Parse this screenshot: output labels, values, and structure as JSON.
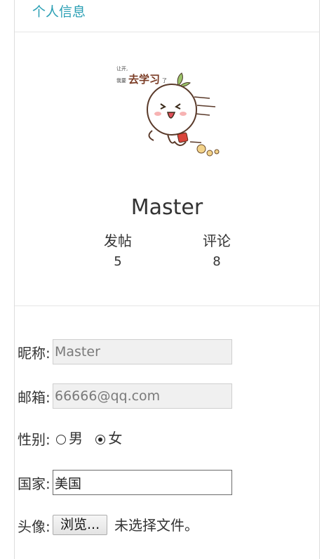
{
  "panel": {
    "title": "个人信息"
  },
  "profile": {
    "avatar_caption": "让开, 我要去学习了",
    "username": "Master",
    "stats": [
      {
        "label": "发帖",
        "value": "5"
      },
      {
        "label": "评论",
        "value": "8"
      }
    ]
  },
  "form": {
    "nickname": {
      "label": "昵称:",
      "value": "Master"
    },
    "email": {
      "label": "邮箱:",
      "value": "66666@qq.com"
    },
    "gender": {
      "label": "性别:",
      "options": [
        {
          "label": "男",
          "checked": false
        },
        {
          "label": "女",
          "checked": true
        }
      ]
    },
    "country": {
      "label": "国家:",
      "value": "美国"
    },
    "avatar": {
      "label": "头像:",
      "button": "浏览...",
      "status": "未选择文件。"
    }
  },
  "colors": {
    "accent": "#2a9fb4",
    "border": "#dddddd"
  }
}
